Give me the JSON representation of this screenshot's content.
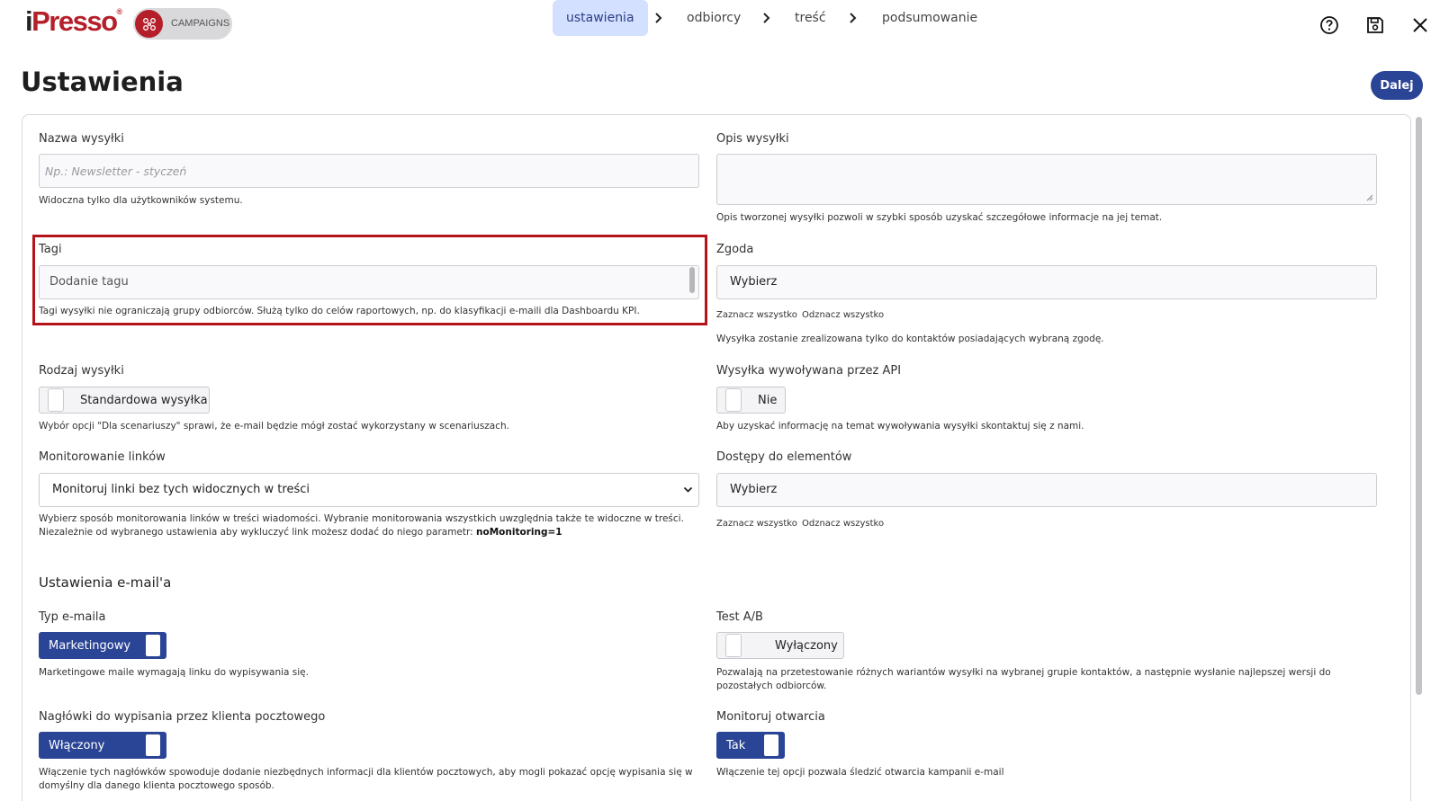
{
  "app": {
    "logo_text_i": "i",
    "logo_text": "Presso",
    "logo_reg": "®",
    "module_label": "CAMPAIGNS"
  },
  "steps": [
    {
      "label": "ustawienia",
      "active": true
    },
    {
      "label": "odbiorcy",
      "active": false
    },
    {
      "label": "treść",
      "active": false
    },
    {
      "label": "podsumowanie",
      "active": false
    }
  ],
  "top_icons": [
    "help-icon",
    "save-icon",
    "close-icon"
  ],
  "page": {
    "title": "Ustawienia",
    "next_label": "Dalej"
  },
  "form": {
    "name": {
      "label": "Nazwa wysyłki",
      "placeholder": "Np.: Newsletter - styczeń",
      "help": "Widoczna tylko dla użytkowników systemu."
    },
    "description": {
      "label": "Opis wysyłki",
      "value": "",
      "help": "Opis tworzonej wysyłki pozwoli w szybki sposób uzyskać szczegółowe informacje na jej temat."
    },
    "tags": {
      "label": "Tagi",
      "placeholder": "Dodanie tagu",
      "help": "Tagi wysyłki nie ograniczają grupy odbiorców. Służą tylko do celów raportowych, np. do klasyfikacji e-maili dla Dashboardu KPI."
    },
    "consent": {
      "label": "Zgoda",
      "value": "Wybierz",
      "select_all": "Zaznacz wszystko",
      "deselect_all": "Odznacz wszystko",
      "help": "Wysyłka zostanie zrealizowana tylko do kontaktów posiadających wybraną zgodę."
    },
    "send_type": {
      "label": "Rodzaj wysyłki",
      "value": "Standardowa wysyłka",
      "on": false,
      "help": "Wybór opcji \"Dla scenariuszy\" sprawi, że e-mail będzie mógł zostać wykorzystany w scenariuszach."
    },
    "api_send": {
      "label": "Wysyłka wywoływana przez API",
      "value": "Nie",
      "on": false,
      "help": "Aby uzyskać informację na temat wywoływania wysyłki skontaktuj się z nami."
    },
    "link_monitoring": {
      "label": "Monitorowanie linków",
      "value": "Monitoruj linki bez tych widocznych w treści",
      "help_line1": "Wybierz sposób monitorowania linków w treści wiadomości. Wybranie monitorowania wszystkich uwzględnia także te widoczne w treści.",
      "help_line2_prefix": "Niezależnie od wybranego ustawienia aby wykluczyć link możesz dodać do niego parametr: ",
      "help_line2_param": "noMonitoring=1"
    },
    "element_access": {
      "label": "Dostępy do elementów",
      "value": "Wybierz",
      "select_all": "Zaznacz wszystko",
      "deselect_all": "Odznacz wszystko"
    }
  },
  "email_settings": {
    "title": "Ustawienia e-mail'a",
    "email_type": {
      "label": "Typ e-maila",
      "value": "Marketingowy",
      "on": true,
      "help": "Marketingowe maile wymagają linku do wypisywania się."
    },
    "ab_test": {
      "label": "Test A/B",
      "value": "Wyłączony",
      "on": false,
      "help_line1": "Pozwalają na przetestowanie różnych wariantów wysyłki na wybranej grupie kontaktów, a następnie wysłanie najlepszej wersji do",
      "help_line2": "pozostałych odbiorców."
    },
    "unsubscribe_headers": {
      "label": "Nagłówki do wypisania przez klienta pocztowego",
      "value": "Włączony",
      "on": true,
      "help_line1": "Włączenie tych nagłówków spowoduje dodanie niezbędnych informacji dla klientów pocztowych, aby mogli pokazać opcję wypisania się w",
      "help_line2": "domyślny dla danego klienta pocztowego sposób."
    },
    "track_opens": {
      "label": "Monitoruj otwarcia",
      "value": "Tak",
      "on": true,
      "help": "Włączenie tej opcji pozwala śledzić otwarcia kampanii e-mail"
    }
  },
  "colors": {
    "brand_red": "#b51f2a",
    "accent_blue": "#2b4596",
    "active_step_bg": "#d3e0ff",
    "highlight_border": "#b3141a"
  }
}
